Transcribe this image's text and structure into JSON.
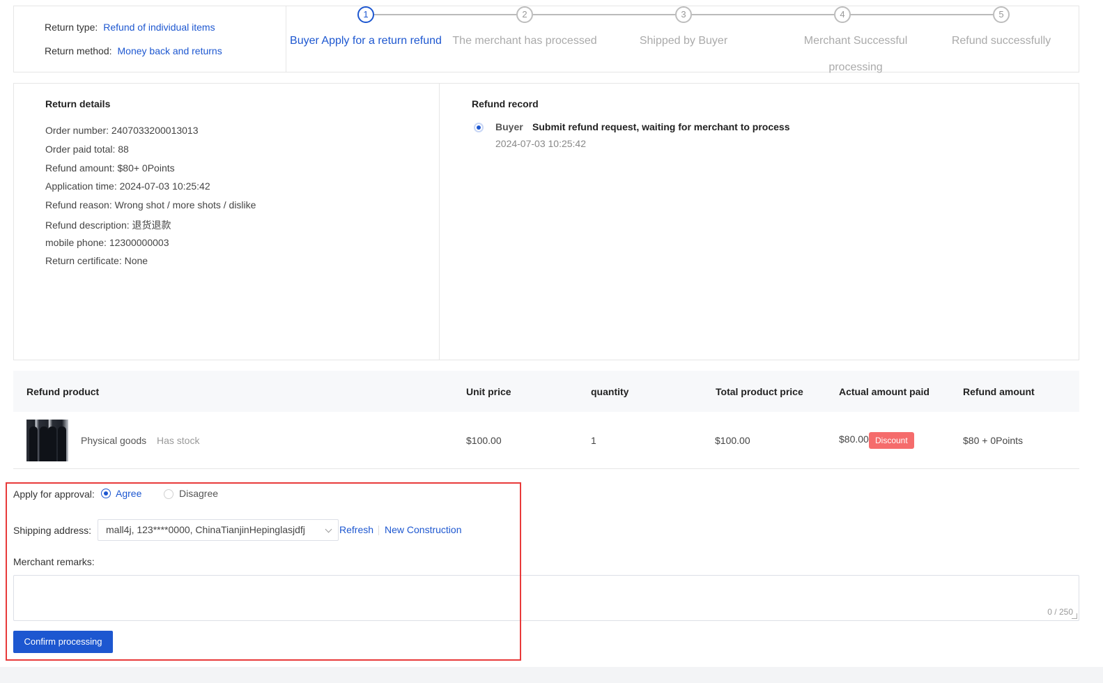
{
  "header": {
    "return_type_label": "Return type:",
    "return_type_value": "Refund of individual items",
    "return_method_label": "Return method:",
    "return_method_value": "Money back and returns"
  },
  "steps": [
    {
      "num": "1",
      "label": "Buyer Apply for a return refund",
      "active": true
    },
    {
      "num": "2",
      "label": "The merchant has processed",
      "active": false
    },
    {
      "num": "3",
      "label": "Shipped by Buyer",
      "active": false
    },
    {
      "num": "4",
      "label": "Merchant Successful processing",
      "active": false
    },
    {
      "num": "5",
      "label": "Refund successfully",
      "active": false
    }
  ],
  "return_details": {
    "title": "Return details",
    "lines": [
      "Order number:  2407033200013013",
      "Order paid total:  88",
      "Refund amount:  $80+ 0Points",
      "Application time:  2024-07-03 10:25:42",
      "Refund reason:  Wrong shot / more shots / dislike",
      "Refund description:  退货退款",
      "mobile phone:  12300000003",
      "Return certificate:  None"
    ]
  },
  "refund_record": {
    "title": "Refund record",
    "actor": "Buyer",
    "message": "Submit refund request, waiting for merchant to process",
    "time": "2024-07-03 10:25:42"
  },
  "table": {
    "headers": [
      "Refund product",
      "Unit price",
      "quantity",
      "Total product price",
      "Actual amount paid",
      "Refund amount"
    ],
    "row": {
      "product_name": "Physical goods",
      "stock": "Has stock",
      "unit_price": "$100.00",
      "quantity": "1",
      "total_price": "$100.00",
      "actual_paid": "$80.00",
      "badge": "Discount",
      "refund_amount": "$80 + 0Points"
    }
  },
  "form": {
    "approval_label": "Apply for approval:",
    "agree": "Agree",
    "disagree": "Disagree",
    "approval_selected": "Agree",
    "shipping_label": "Shipping address:",
    "shipping_value": "mall4j,  123****0000,  ChinaTianjinHepinglasjdfj",
    "refresh": "Refresh",
    "new_construction": "New Construction",
    "remarks_label": "Merchant remarks:",
    "remarks_value": "",
    "remarks_counter": "0 / 250",
    "confirm": "Confirm processing"
  },
  "colors": {
    "primary": "#1d57d0",
    "danger": "#f56c6c",
    "highlight_frame": "#e83a3a"
  }
}
